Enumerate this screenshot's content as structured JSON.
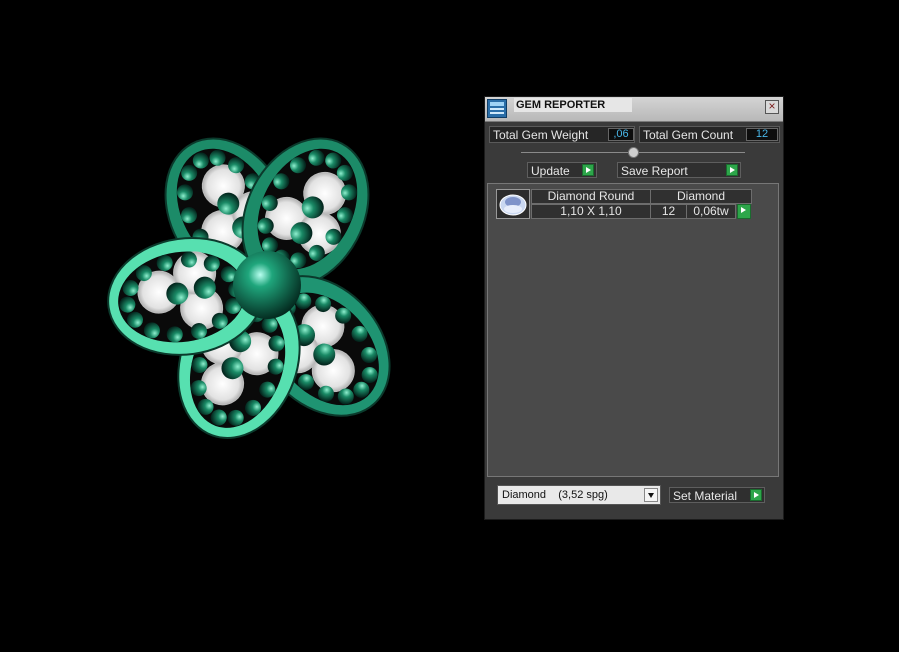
{
  "panel": {
    "title": "GEM REPORTER",
    "title_icon": "gem-report-icon",
    "close_icon": "close-icon",
    "close_glyph": "×"
  },
  "stats": {
    "weight_label": "Total Gem Weight",
    "weight_value": ",06",
    "count_label": "Total Gem Count",
    "count_value": "12"
  },
  "buttons": {
    "update_label": "Update",
    "save_label": "Save Report",
    "set_material_label": "Set Material"
  },
  "table": {
    "headers": [
      "Diamond Round",
      "Diamond"
    ],
    "rows": [
      {
        "size": "1,10 X 1,10",
        "count": "12",
        "weight": "0,06tw"
      }
    ]
  },
  "material": {
    "selected": "Diamond    (3,52 spg)"
  },
  "colors": {
    "gem_green": "#1f9e78",
    "gem_light": "#57e0b0",
    "accent_arrow": "#2da64a",
    "value_text": "#49b6e8"
  }
}
